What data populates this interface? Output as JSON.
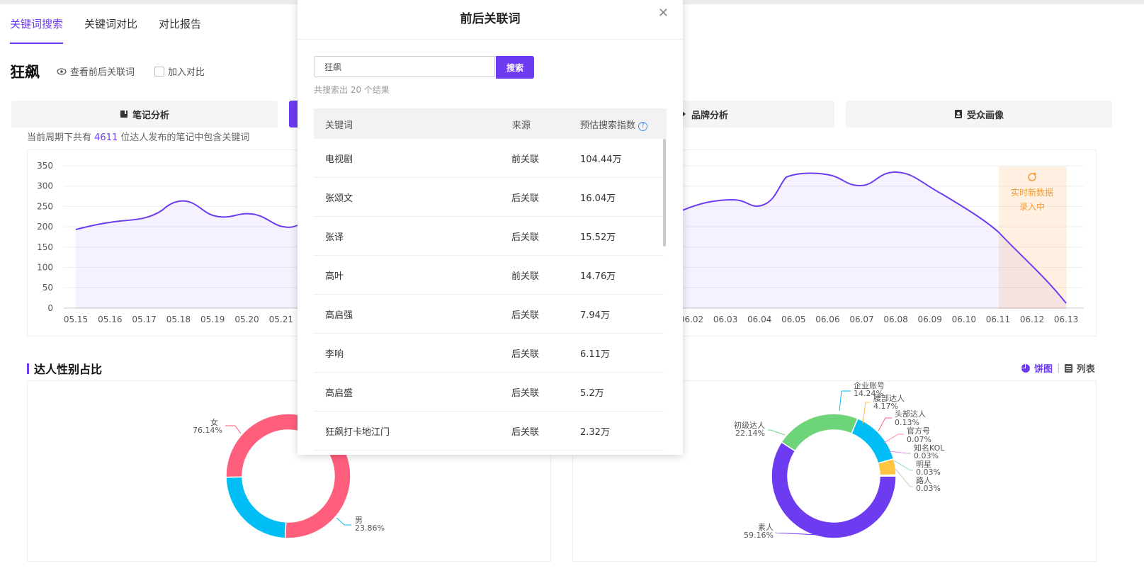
{
  "tabs": [
    "关键词搜索",
    "关键词对比",
    "对比报告"
  ],
  "keyword": "狂飙",
  "options": {
    "related": "查看前后关联词",
    "compare": "加入对比"
  },
  "action_buttons": {
    "note": "笔记分析",
    "brand": "品牌分析",
    "audience": "受众画像"
  },
  "subtext": {
    "prefix": "当前周期下共有",
    "count": "4611",
    "suffix": "位达人发布的笔记中包含关键词"
  },
  "trend": {
    "left_x_labels": [
      "05.15",
      "05.16",
      "05.17",
      "05.18",
      "05.19",
      "05.20",
      "05.21"
    ],
    "right_x_labels": [
      "06.02",
      "06.03",
      "06.04",
      "06.05",
      "06.06",
      "06.07",
      "06.08",
      "06.09",
      "06.10",
      "06.11",
      "06.12",
      "06.13"
    ],
    "y_ticks": [
      "350",
      "300",
      "250",
      "200",
      "150",
      "100",
      "50",
      "0"
    ],
    "realtime_line1": "实时新数据",
    "realtime_line2": "录入中"
  },
  "gender_section": {
    "title": "达人性别占比"
  },
  "view_toggle": {
    "pie": "饼图",
    "list": "列表"
  },
  "colors": {
    "accent": "#6d3cf0",
    "female": "#ff5e7d",
    "male": "#00bef5"
  },
  "chart_data": [
    {
      "type": "pie",
      "labels": [
        "女",
        "男"
      ],
      "values": [
        76.14,
        23.86
      ],
      "value_labels": [
        "76.14%",
        "23.86%"
      ]
    },
    {
      "type": "pie",
      "labels": [
        "素人",
        "初级达人",
        "企业账号",
        "腰部达人",
        "头部达人",
        "官方号",
        "知名KOL",
        "明星",
        "路人"
      ],
      "values": [
        59.16,
        22.14,
        14.24,
        4.17,
        0.13,
        0.07,
        0.03,
        0.03,
        0.03
      ],
      "value_labels": [
        "59.16%",
        "22.14%",
        "14.24%",
        "4.17%",
        "0.13%",
        "0.07%",
        "0.03%",
        "0.03%",
        "0.03%"
      ]
    }
  ],
  "modal": {
    "title": "前后关联词",
    "search_value": "狂飙",
    "search_button": "搜索",
    "result_count": "共搜索出 20 个结果",
    "headers": {
      "keyword": "关键词",
      "source": "来源",
      "index": "预估搜索指数"
    },
    "rows": [
      {
        "keyword": "电视剧",
        "source": "前关联",
        "index": "104.44万"
      },
      {
        "keyword": "张颂文",
        "source": "后关联",
        "index": "16.04万"
      },
      {
        "keyword": "张译",
        "source": "后关联",
        "index": "15.52万"
      },
      {
        "keyword": "高叶",
        "source": "前关联",
        "index": "14.76万"
      },
      {
        "keyword": "高启强",
        "source": "后关联",
        "index": "7.94万"
      },
      {
        "keyword": "李响",
        "source": "后关联",
        "index": "6.11万"
      },
      {
        "keyword": "高启盛",
        "source": "后关联",
        "index": "5.2万"
      },
      {
        "keyword": "狂飙打卡地江门",
        "source": "后关联",
        "index": "2.32万"
      }
    ]
  }
}
